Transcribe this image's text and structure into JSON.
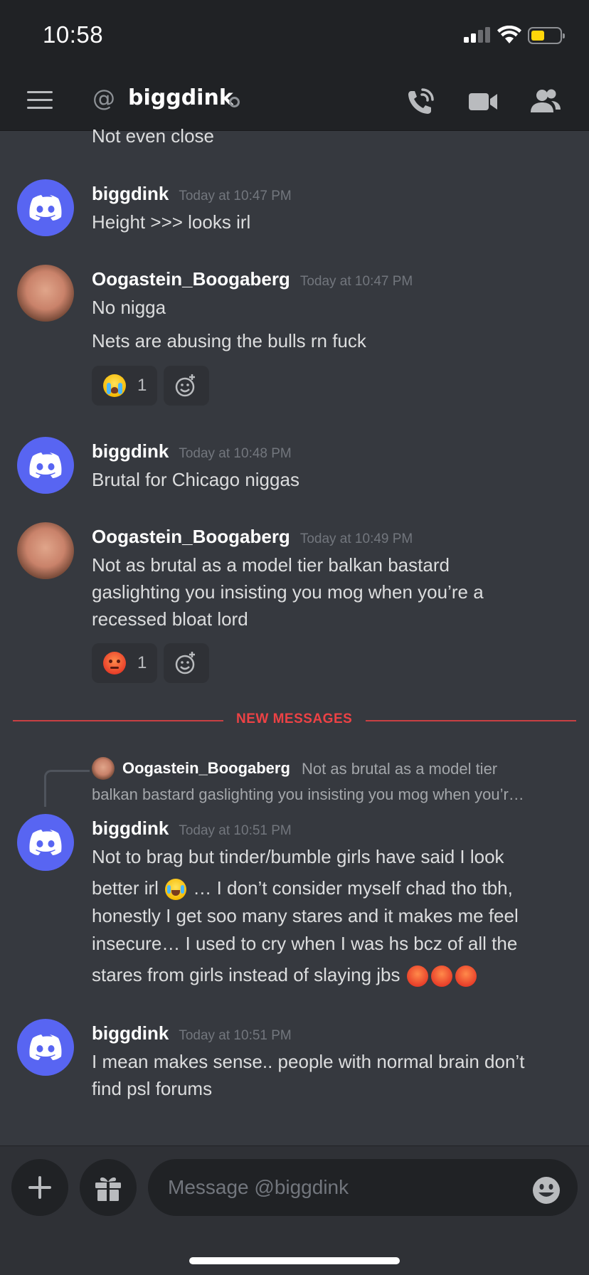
{
  "status_bar": {
    "time": "10:58"
  },
  "header": {
    "channel_name": "biggdink"
  },
  "messages": [
    {
      "text": "Not even close"
    },
    {
      "username": "biggdink",
      "timestamp": "Today at 10:47 PM",
      "lines": [
        "Height >>> looks irl"
      ]
    },
    {
      "username": "Oogastein_Boogaberg",
      "timestamp": "Today at 10:47 PM",
      "lines": [
        "No nigga",
        "Nets are abusing the bulls rn fuck"
      ],
      "reaction": {
        "emoji": "loudly-crying-face",
        "count": "1"
      }
    },
    {
      "username": "biggdink",
      "timestamp": "Today at 10:48 PM",
      "lines": [
        "Brutal for Chicago niggas"
      ]
    },
    {
      "username": "Oogastein_Boogaberg",
      "timestamp": "Today at 10:49 PM",
      "lines": [
        "Not as brutal as a model tier balkan bastard",
        "gaslighting you insisting you mog when you’re a",
        "recessed bloat lord"
      ],
      "reaction": {
        "emoji": "angry-face",
        "count": "1"
      }
    },
    {
      "username": "biggdink",
      "timestamp": "Today at 10:51 PM",
      "lines": [
        "Not to brag but tinder/bumble girls have said I look",
        "better irl",
        "… I don’t consider myself chad tho tbh,",
        "honestly I get soo many stares and it makes me feel",
        "insecure… I used to cry when I was hs bcz of all the",
        "stares from girls instead of slaying jbs"
      ]
    },
    {
      "username": "biggdink",
      "timestamp": "Today at 10:51 PM",
      "lines": [
        "I mean makes sense.. people with normal brain don’t",
        "find psl forums"
      ]
    }
  ],
  "divider": {
    "label": "NEW MESSAGES"
  },
  "reply": {
    "username": "Oogastein_Boogaberg",
    "preview_1": "Not as brutal as a model tier",
    "preview_2": "balkan bastard gaslighting you insisting you mog when you’r…"
  },
  "composer": {
    "placeholder": "Message @biggdink"
  },
  "colors": {
    "blurple": "#5865f2",
    "background": "#36393f",
    "header": "#202225",
    "new_messages": "#ed4245"
  }
}
